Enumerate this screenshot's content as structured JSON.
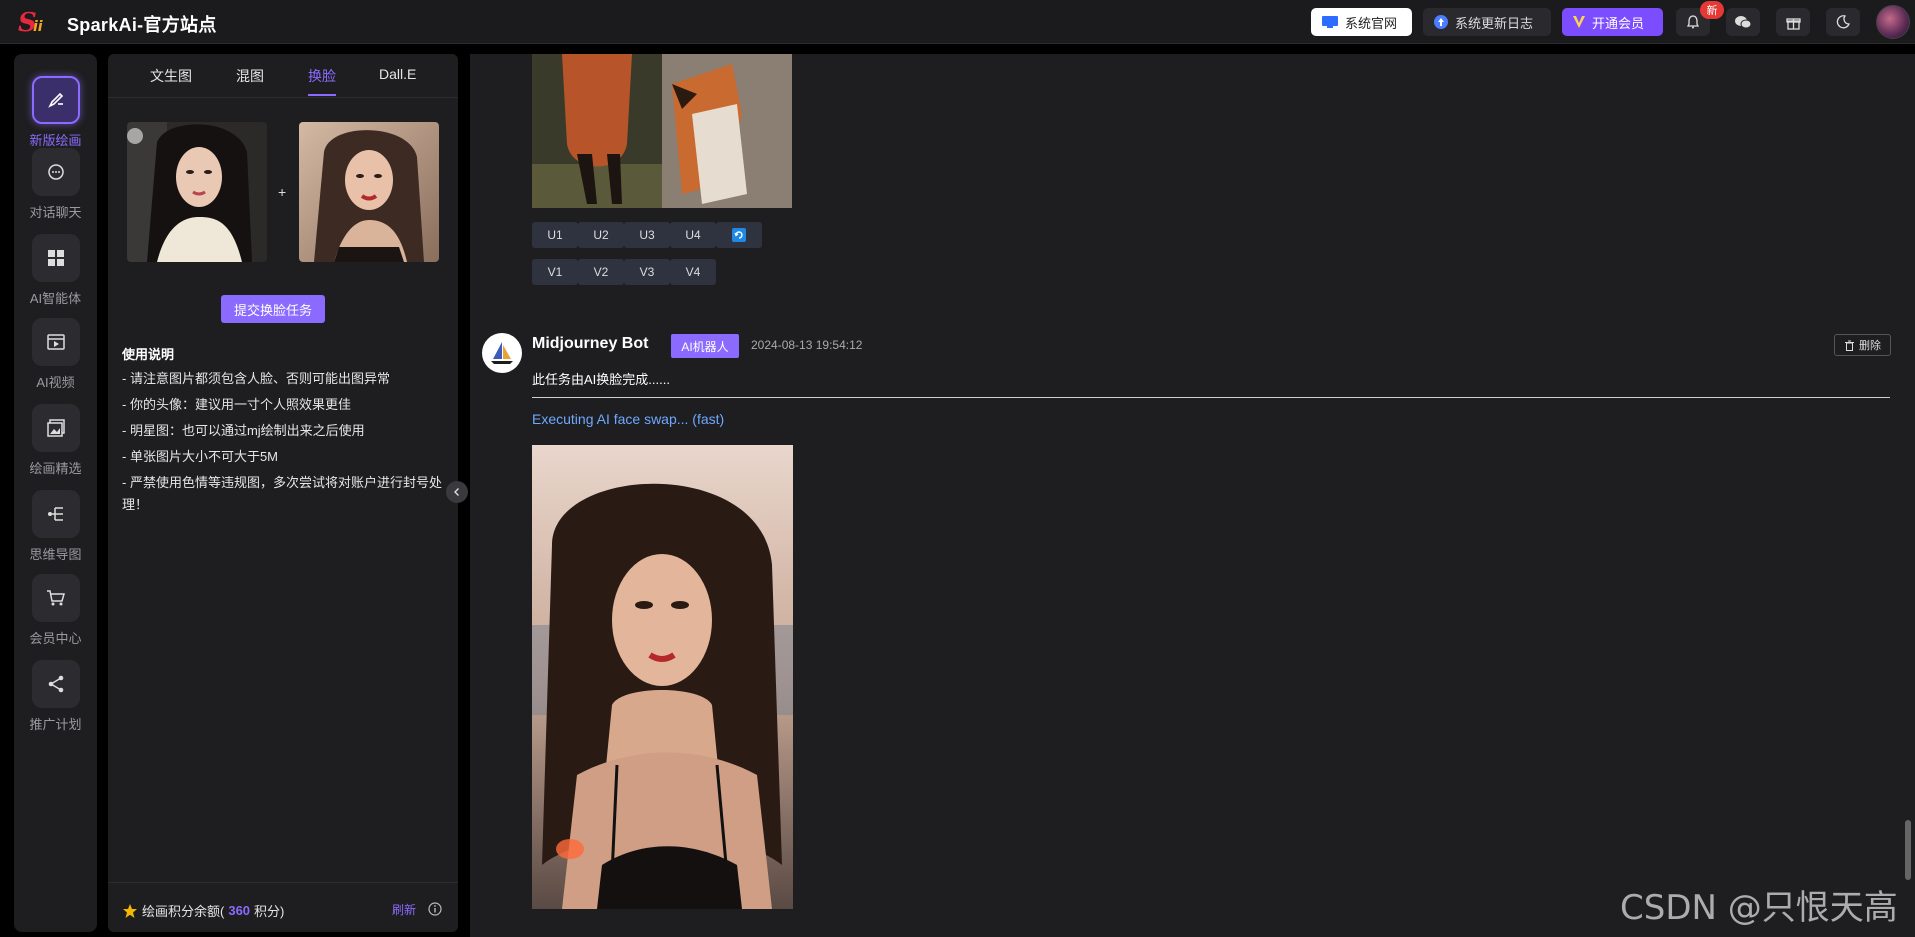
{
  "app": {
    "brand": "SparkAi-官方站点"
  },
  "topbar": {
    "site_label": "系统官网",
    "changelog_label": "系统更新日志",
    "vip_label": "开通会员",
    "new_badge": "新",
    "icons": [
      "bell-icon",
      "wechat-icon",
      "gift-icon",
      "moon-icon"
    ]
  },
  "nav": {
    "items": [
      {
        "label": "新版绘画",
        "icon": "brush-icon"
      },
      {
        "label": "对话聊天",
        "icon": "chat-icon"
      },
      {
        "label": "AI智能体",
        "icon": "grid-icon"
      },
      {
        "label": "AI视频",
        "icon": "video-icon"
      },
      {
        "label": "绘画精选",
        "icon": "gallery-icon"
      },
      {
        "label": "思维导图",
        "icon": "mindmap-icon"
      },
      {
        "label": "会员中心",
        "icon": "cart-icon"
      },
      {
        "label": "推广计划",
        "icon": "share-icon"
      }
    ]
  },
  "panel": {
    "tabs": [
      "文生图",
      "混图",
      "换脸",
      "Dall.E"
    ],
    "active_tab": "换脸",
    "plus": "+",
    "submit_label": "提交换脸任务",
    "usage_title": "使用说明",
    "usage": [
      "- 请注意图片都须包含人脸、否则可能出图异常",
      "- 你的头像：建议用一寸个人照效果更佳",
      "- 明星图：也可以通过mj绘制出来之后使用",
      "- 单张图片大小不可大于5M",
      "- 严禁使用色情等违规图，多次尝试将对账户进行封号处理！"
    ],
    "credit_prefix": "绘画积分余额(",
    "credit_value": "360",
    "credit_suffix": "积分)",
    "refresh_label": "刷新"
  },
  "main": {
    "u_buttons": [
      "U1",
      "U2",
      "U3",
      "U4"
    ],
    "v_buttons": [
      "V1",
      "V2",
      "V3",
      "V4"
    ],
    "message": {
      "author": "Midjourney Bot",
      "badge": "AI机器人",
      "time": "2024-08-13 19:54:12",
      "delete_label": "删除",
      "text": "此任务由AI换脸完成......",
      "status": "Executing AI face swap...  (fast)"
    }
  },
  "watermark": "CSDN @只恨天高",
  "colors": {
    "accent": "#8b6bff",
    "link": "#6ea8ff",
    "bg": "#1e1e20"
  }
}
